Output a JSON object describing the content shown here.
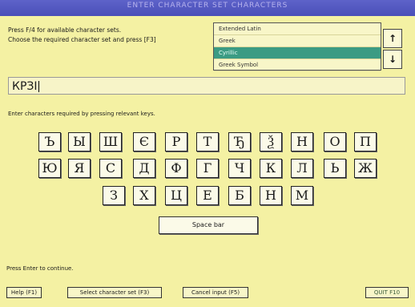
{
  "window": {
    "title": "ENTER CHARACTER SET CHARACTERS"
  },
  "instructions": {
    "line1": "Press F/4  for available character sets.",
    "line2": "Choose the required character set and press [F3]"
  },
  "charset_list": {
    "items": [
      "Extended Latin",
      "Greek",
      "Cyrillic",
      "Greek Symbol"
    ],
    "selected_index": 2,
    "up_arrow": "↑",
    "down_arrow": "↓"
  },
  "input": {
    "value": "КРЗІ"
  },
  "hint": "Enter characters required by pressing relevant keys.",
  "keyboard": {
    "row1": [
      "Ъ",
      "Ы",
      "Ш",
      "Є",
      "Р",
      "Т",
      "Ђ",
      "Ѯ",
      "Н",
      "О",
      "П"
    ],
    "row2": [
      "Ю",
      "Я",
      "С",
      "Д",
      "Ф",
      "Г",
      "Ч",
      "К",
      "Л",
      "Ь",
      "Ж"
    ],
    "row3": [
      "З",
      "Х",
      "Ц",
      "Е",
      "Б",
      "Н",
      "М"
    ],
    "space_label": "Space bar"
  },
  "continue_text": "Press Enter to continue.",
  "buttons": {
    "help": "Help (F1)",
    "select_set": "Select character set (F3)",
    "cancel": "Cancel input (F5)",
    "quit": "QUIT F10"
  }
}
